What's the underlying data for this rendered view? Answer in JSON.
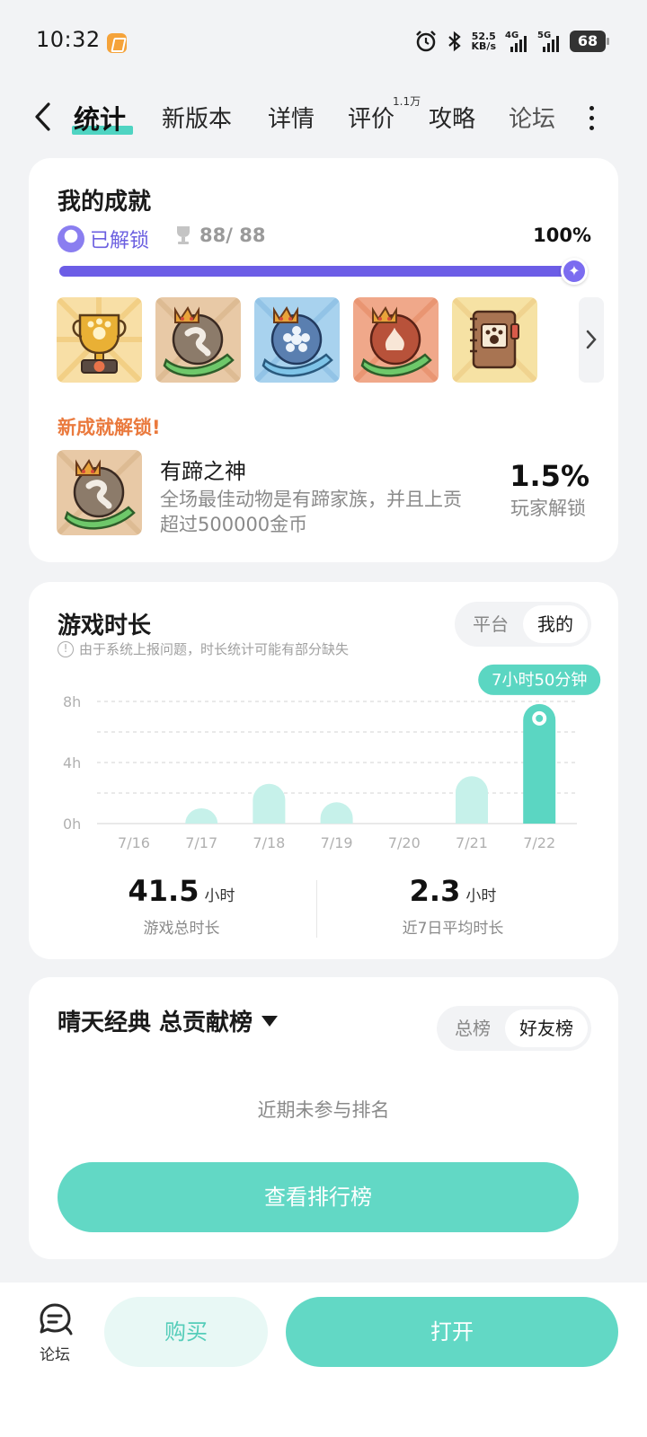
{
  "status_bar": {
    "time": "10:32",
    "net_speed_value": "52.5",
    "net_speed_unit": "KB/s",
    "net1": "4G",
    "net2": "5G",
    "battery": "68"
  },
  "tabs": {
    "items": [
      "统计",
      "新版本",
      "详情",
      "评价",
      "攻略",
      "论坛"
    ],
    "active": "统计",
    "review_badge": "1.1万"
  },
  "achievements": {
    "title": "我的成就",
    "unlocked_label": "已解锁",
    "count": "88/ 88",
    "percent_label": "100%",
    "progress": 1.0,
    "badges": [
      "golden-paw-trophy",
      "crowned-rock-hand",
      "crowned-snowflake-hand",
      "crowned-fire-hand",
      "paw-notebook"
    ],
    "new_label": "新成就解锁!",
    "new_name": "有蹄之神",
    "new_desc": "全场最佳动物是有蹄家族，并且上贡超过500000金币",
    "new_rate": "1.5%",
    "new_rate_label": "玩家解锁"
  },
  "playtime": {
    "title": "游戏时长",
    "note": "由于系统上报问题，时长统计可能有部分缺失",
    "seg_platform": "平台",
    "seg_mine": "我的",
    "tooltip": "7小时50分钟",
    "total_value": "41.5",
    "total_unit": "小时",
    "total_label": "游戏总时长",
    "avg_value": "2.3",
    "avg_unit": "小时",
    "avg_label": "近7日平均时长"
  },
  "chart_data": {
    "type": "bar",
    "categories": [
      "7/16",
      "7/17",
      "7/18",
      "7/19",
      "7/20",
      "7/21",
      "7/22"
    ],
    "values": [
      0,
      1.0,
      2.6,
      1.4,
      0,
      3.1,
      7.83
    ],
    "y_ticks": [
      "0h",
      "4h",
      "8h"
    ],
    "ylim": [
      0,
      8
    ],
    "grid": true,
    "highlight_index": 6,
    "colors": {
      "bar": "#c6f1ea",
      "highlight": "#5bd6c2"
    }
  },
  "ranking": {
    "title": "晴天经典 总贡献榜",
    "seg_total": "总榜",
    "seg_friends": "好友榜",
    "empty_text": "近期未参与排名",
    "view_button": "查看排行榜"
  },
  "bottom_bar": {
    "forum_label": "论坛",
    "buy_label": "购买",
    "open_label": "打开"
  }
}
